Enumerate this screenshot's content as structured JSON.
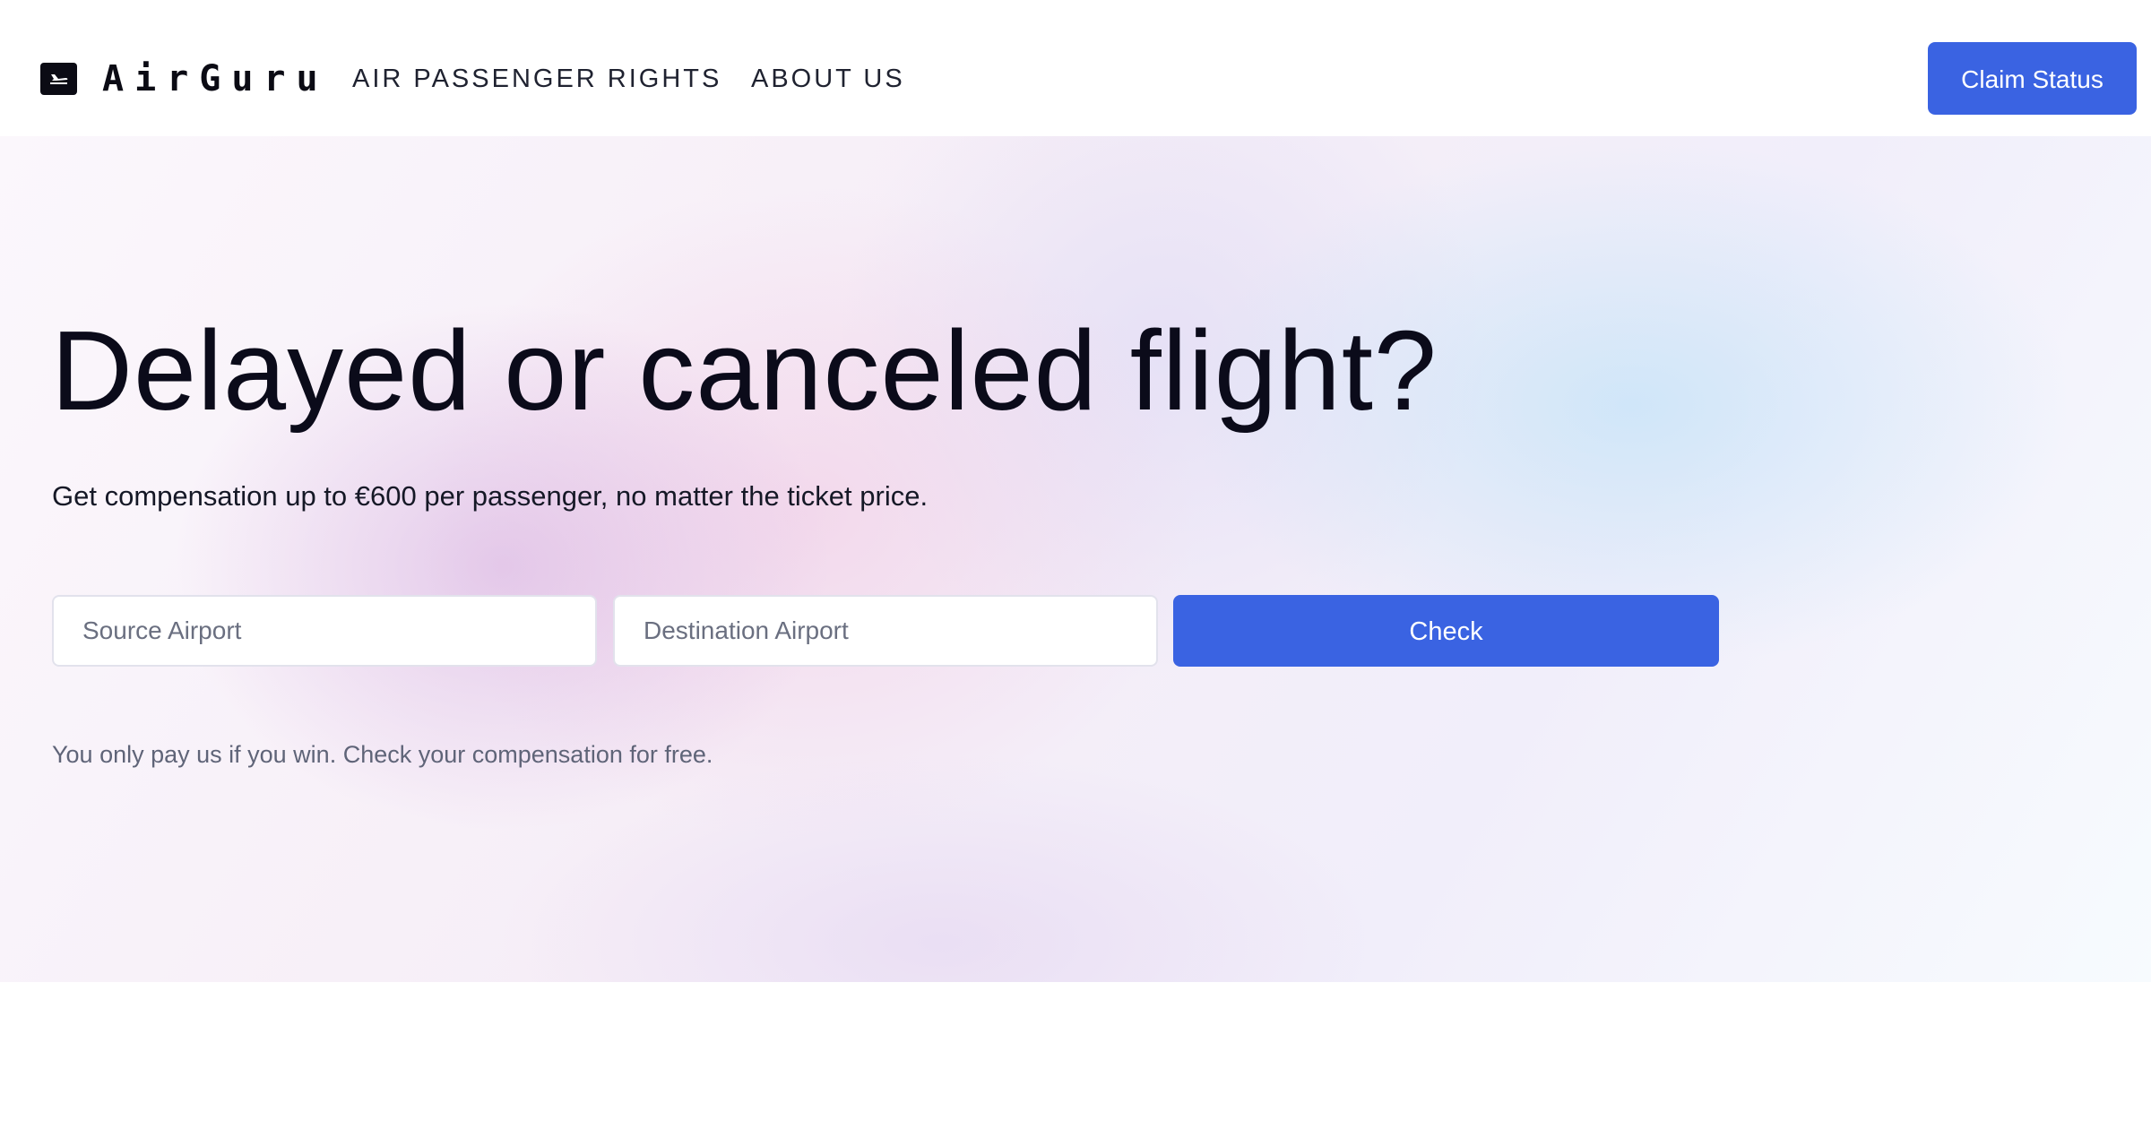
{
  "header": {
    "logo_text": "AirGuru",
    "logo_icon": "plane-ticket-icon",
    "nav": [
      {
        "label": "AIR PASSENGER RIGHTS"
      },
      {
        "label": "ABOUT US"
      }
    ],
    "claim_status_label": "Claim Status"
  },
  "hero": {
    "headline": "Delayed or canceled flight?",
    "subhead": "Get compensation up to €600 per passenger, no matter the ticket price.",
    "source_placeholder": "Source Airport",
    "destination_placeholder": "Destination Airport",
    "source_value": "",
    "destination_value": "",
    "check_label": "Check",
    "note": "You only pay us if you win. Check your compensation for free."
  },
  "colors": {
    "accent": "#3a63e2",
    "text_dark": "#0b0b1a",
    "text_muted": "#5f6478"
  }
}
